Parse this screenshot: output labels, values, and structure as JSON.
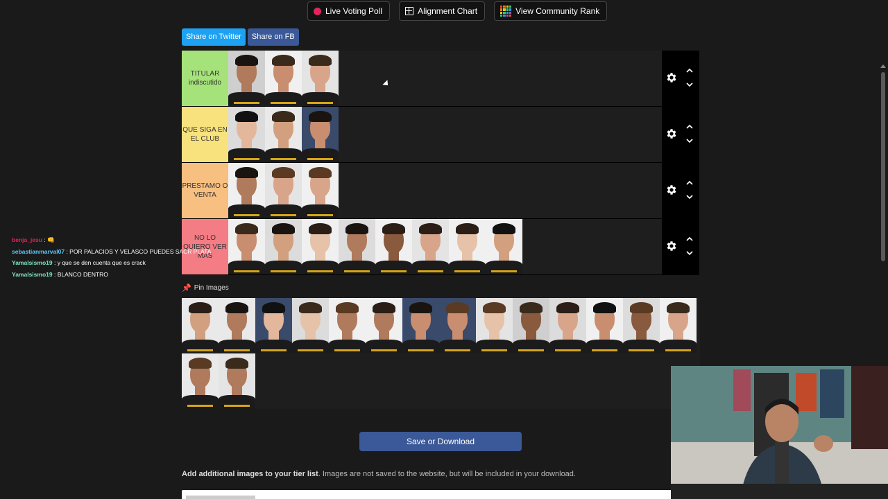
{
  "top_buttons": {
    "live_voting": "Live Voting Poll",
    "alignment": "Alignment Chart",
    "community": "View Community Rank"
  },
  "share": {
    "twitter": "Share on Twitter",
    "facebook": "Share on FB"
  },
  "tiers": [
    {
      "label": "TITULAR indiscutido",
      "color": "#a6e27a",
      "players": 3
    },
    {
      "label": "QUE SIGA EN EL CLUB",
      "color": "#f7e27e",
      "players": 3
    },
    {
      "label": "PRESTAMO O VENTA",
      "color": "#f7bf80",
      "players": 3
    },
    {
      "label": "NO LO QUIERO VER MAS",
      "color": "#f47c84",
      "players": 8
    }
  ],
  "pin_images": {
    "label": "Pin Images",
    "count": 16
  },
  "save_button": "Save or Download",
  "add_images": {
    "bold": "Add additional images to your tier list",
    "rest": ". Images are not saved to the website, but will be included in your download."
  },
  "chat": [
    {
      "user": "benja_jesu",
      "color": "#e0245e",
      "msg": ": 👊"
    },
    {
      "user": "sebastianmarval07",
      "color": "#5ac8fa",
      "msg": ": POR PALACIOS Y VELASCO PUEDES SACR PLATA"
    },
    {
      "user": "Yamalsismo19",
      "color": "#7ee8c4",
      "msg": ": y que se den cuenta que es crack"
    },
    {
      "user": "Yamalsismo19",
      "color": "#7ee8c4",
      "msg": ": BLANCO DENTRO"
    }
  ],
  "colors": {
    "twitter": "#1da1f2",
    "facebook": "#3b5998",
    "save": "#3b5998"
  }
}
